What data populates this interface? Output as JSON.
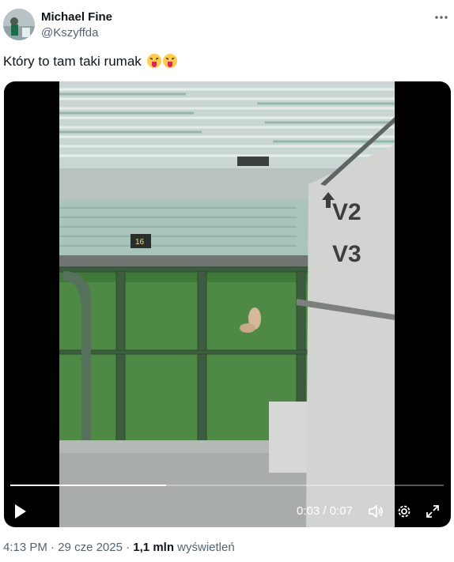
{
  "author": {
    "name": "Michael Fine",
    "handle": "@Kszyffda",
    "avatar_icon": "avatar-photo"
  },
  "more_icon": "ellipsis-icon",
  "tweet": {
    "text": "Który to tam taki rumak",
    "emojis": [
      "squinting-face-with-tongue",
      "squinting-face-with-tongue"
    ]
  },
  "video": {
    "scene": {
      "sign_v2": "V2",
      "sign_v3": "V3",
      "scoreboard_text": "16"
    },
    "time_current": "0:03",
    "time_separator": "/",
    "time_total": "0:07",
    "progress_fraction": 0.36,
    "icons": [
      "play-icon",
      "volume-icon",
      "settings-icon",
      "fullscreen-icon"
    ]
  },
  "footer": {
    "time": "4:13 PM",
    "sep1": "·",
    "date": "29 cze 2025",
    "sep2": "·",
    "views_count": "1,1 mln",
    "views_label": "wyświetleń"
  },
  "colors": {
    "text": "#0f1419",
    "secondary": "#536471",
    "video_bg": "#000000"
  }
}
